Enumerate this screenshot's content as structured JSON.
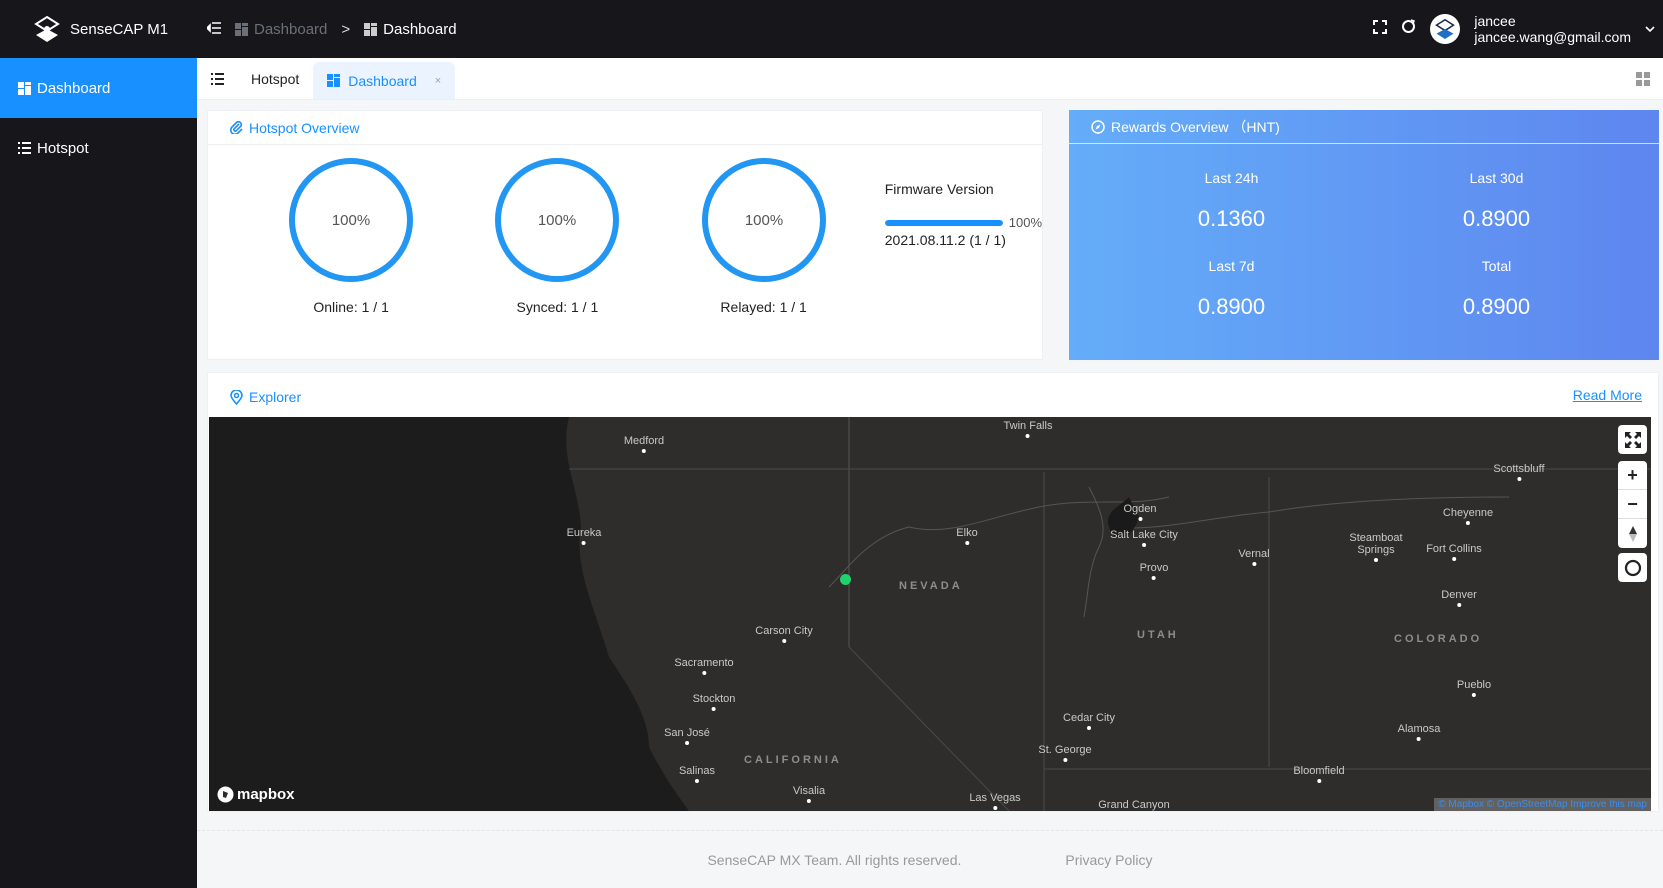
{
  "app": {
    "title": "SenseCAP M1"
  },
  "breadcrumb": [
    {
      "label": "Dashboard"
    },
    {
      "separator": ">"
    },
    {
      "label": "Dashboard"
    }
  ],
  "user": {
    "name": "jancee",
    "email": "jancee.wang@gmail.com"
  },
  "sidebar": {
    "items": [
      {
        "label": "Dashboard",
        "icon": "dashboard-icon",
        "active": true
      },
      {
        "label": "Hotspot",
        "icon": "list-icon",
        "active": false
      }
    ]
  },
  "tabs": [
    {
      "label": "Hotspot",
      "active": false
    },
    {
      "label": "Dashboard",
      "active": true,
      "close": "×"
    }
  ],
  "hotspot_overview": {
    "title": "Hotspot Overview",
    "gauges": [
      {
        "percent_text": "100%",
        "percent": 100,
        "label": "Online: 1 / 1"
      },
      {
        "percent_text": "100%",
        "percent": 100,
        "label": "Synced: 1 / 1"
      },
      {
        "percent_text": "100%",
        "percent": 100,
        "label": "Relayed: 1 / 1"
      }
    ],
    "firmware": {
      "title": "Firmware Version",
      "progress": 100,
      "progress_text": "100%",
      "version": "2021.08.11.2 (1 / 1)"
    }
  },
  "rewards_overview": {
    "title": "Rewards Overview （HNT)",
    "items": [
      {
        "label": "Last 24h",
        "value": "0.1360"
      },
      {
        "label": "Last 30d",
        "value": "0.8900"
      },
      {
        "label": "Last 7d",
        "value": "0.8900"
      },
      {
        "label": "Total",
        "value": "0.8900"
      }
    ]
  },
  "explorer": {
    "title": "Explorer",
    "read_more": "Read More",
    "map": {
      "cities": [
        "Medford",
        "Twin Falls",
        "Scottsbluff",
        "Eureka",
        "Elko",
        "Ogden",
        "Salt Lake City",
        "Cheyenne",
        "Vernal",
        "Steamboat Springs",
        "Fort Collins",
        "Provo",
        "Denver",
        "Carson City",
        "Sacramento",
        "Stockton",
        "San José",
        "Salinas",
        "Visalia",
        "Las Vegas",
        "Grand Canyon",
        "Cedar City",
        "St. George",
        "Pueblo",
        "Alamosa",
        "Bloomfield"
      ],
      "states": [
        "NEVADA",
        "UTAH",
        "COLORADO",
        "CALIFORNIA"
      ],
      "controls": {
        "fullscreen": "fullscreen-icon",
        "zoom_in": "+",
        "zoom_out": "−",
        "compass": "compass-icon",
        "geolocate": "geolocate-icon"
      },
      "logo": "mapbox",
      "attribution": "© Mapbox © OpenStreetMap Improve this map",
      "marker_color": "#1fd36b"
    }
  },
  "footer": {
    "copyright": "SenseCAP MX Team. All rights reserved.",
    "privacy": "Privacy Policy"
  },
  "colors": {
    "accent": "#1890ff",
    "topbar": "#16161b",
    "rewards_gradient_start": "#64adf9",
    "rewards_gradient_end": "#5e86ef"
  }
}
